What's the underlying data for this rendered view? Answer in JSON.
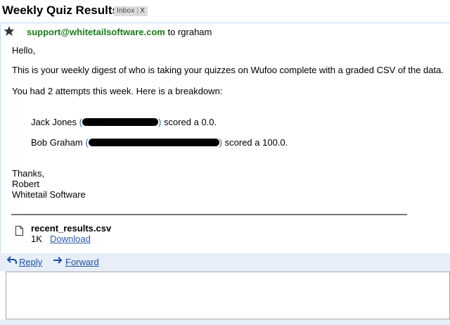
{
  "header": {
    "subject": "Weekly Quiz Results",
    "label": "Inbox",
    "label_separator": "|",
    "label_remove": "X"
  },
  "message": {
    "sender": "support@whitetailsoftware.com",
    "recipient_text": "to rgraham",
    "greeting": "Hello,",
    "intro": "This is your weekly digest of who is taking your quizzes on Wufoo complete with a graded CSV of the data.",
    "attempts_line": "You had 2 attempts this week. Here is a breakdown:",
    "results": [
      {
        "name": "Jack Jones",
        "score_text": "scored a 0.0."
      },
      {
        "name": "Bob Graham",
        "score_text": "scored a 100.0."
      }
    ],
    "signoff": [
      "Thanks,",
      "Robert",
      "Whitetail Software"
    ]
  },
  "attachment": {
    "filename": "recent_results.csv",
    "size": "1K",
    "download_label": "Download"
  },
  "actions": {
    "reply_label": "Reply",
    "forward_label": "Forward"
  },
  "colors": {
    "sender": "#1a7a1a",
    "link": "#2a5db0",
    "reply_bar": "#e8eef7",
    "label_chip": "#dddddd"
  }
}
